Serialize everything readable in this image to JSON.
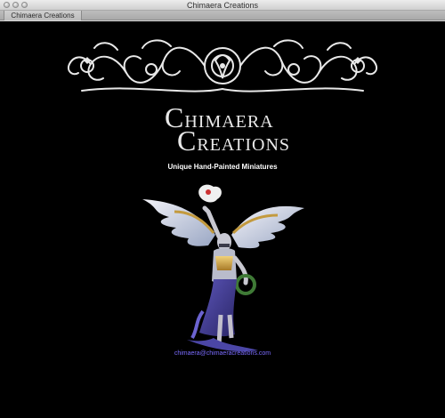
{
  "window": {
    "title": "Chimaera Creations",
    "tab_label": "Chimaera Creations"
  },
  "page": {
    "logo_line1_first": "C",
    "logo_line1_rest": "HIMAERA",
    "logo_line2_first": "C",
    "logo_line2_rest": "REATIONS",
    "tagline": "Unique Hand-Painted Miniatures",
    "email": "chimaera@chimaeracreations.com"
  },
  "colors": {
    "background": "#000000",
    "link": "#7b6cff",
    "text": "#ffffff"
  },
  "icons": {
    "ornament": "scrollwork-banner-icon",
    "figure": "winged-angel-miniature-icon"
  }
}
